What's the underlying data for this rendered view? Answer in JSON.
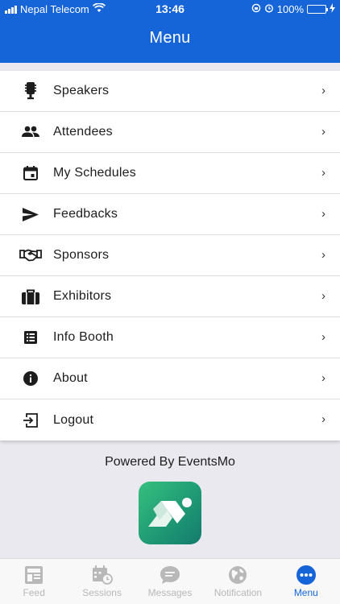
{
  "status_bar": {
    "carrier": "Nepal Telecom",
    "time": "13:46",
    "battery": "100%"
  },
  "header": {
    "title": "Menu"
  },
  "menu": {
    "items": [
      {
        "label": "Speakers",
        "icon": "microphone-icon"
      },
      {
        "label": "Attendees",
        "icon": "people-icon"
      },
      {
        "label": "My Schedules",
        "icon": "calendar-icon"
      },
      {
        "label": "Feedbacks",
        "icon": "send-icon"
      },
      {
        "label": "Sponsors",
        "icon": "handshake-icon"
      },
      {
        "label": "Exhibitors",
        "icon": "briefcase-icon"
      },
      {
        "label": "Info Booth",
        "icon": "list-icon"
      },
      {
        "label": "About",
        "icon": "info-icon"
      },
      {
        "label": "Logout",
        "icon": "logout-icon"
      }
    ],
    "chevron": "›"
  },
  "footer": {
    "powered_by": "Powered By EventsMo"
  },
  "tabbar": {
    "tabs": [
      {
        "label": "Feed",
        "icon": "feed-icon",
        "active": false
      },
      {
        "label": "Sessions",
        "icon": "sessions-calendar-icon",
        "active": false
      },
      {
        "label": "Messages",
        "icon": "messages-icon",
        "active": false
      },
      {
        "label": "Notification",
        "icon": "globe-icon",
        "active": false
      },
      {
        "label": "Menu",
        "icon": "more-icon",
        "active": true
      }
    ]
  },
  "colors": {
    "primary": "#1565d8",
    "tab_inactive": "#b8b8b8",
    "logo_green": "#1f9a74",
    "background": "#e9e9ef"
  }
}
